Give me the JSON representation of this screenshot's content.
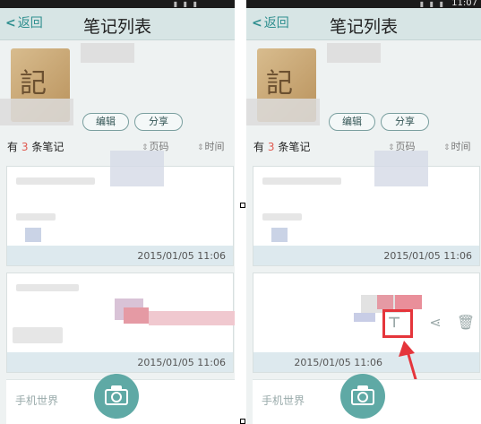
{
  "statusbar": {
    "time": "11:07"
  },
  "header": {
    "back_label": "返回",
    "title": "笔记列表"
  },
  "book": {
    "cover_glyph": "記"
  },
  "actions": {
    "edit_label": "编辑",
    "share_label": "分享"
  },
  "list_header": {
    "count_prefix": "有",
    "count_value": "3",
    "count_suffix": "条笔记",
    "sort_page_label": "页码",
    "sort_time_label": "时间"
  },
  "notes": [
    {
      "date": "2015/01/05 11:06"
    },
    {
      "date": "2015/01/05 11:06"
    }
  ],
  "bottom": {
    "label": "手机世界"
  },
  "colors": {
    "accent": "#2f8f8f",
    "highlight": "#e5353b",
    "footer": "#dde9ee",
    "camera": "#5fa9a5"
  },
  "icons": [
    "chevron-left-icon",
    "camera-icon",
    "pin-top-icon",
    "share-icon",
    "trash-icon",
    "sort-arrow-icon"
  ]
}
